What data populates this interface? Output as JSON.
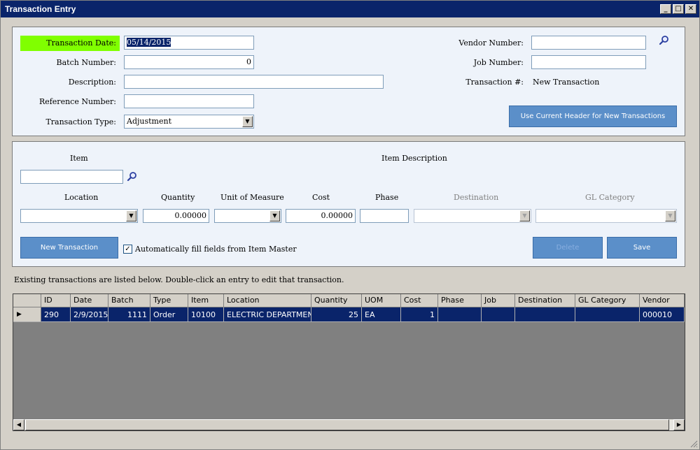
{
  "window": {
    "title": "Transaction Entry",
    "min_label": "_",
    "max_label": "□",
    "close_label": "✕"
  },
  "header": {
    "transaction_date_label": "Transaction Date:",
    "transaction_date_value": "05/14/2015",
    "batch_number_label": "Batch Number:",
    "batch_number_value": "0",
    "description_label": "Description:",
    "description_value": "",
    "reference_number_label": "Reference Number:",
    "reference_number_value": "",
    "transaction_type_label": "Transaction Type:",
    "transaction_type_value": "Adjustment",
    "vendor_number_label": "Vendor Number:",
    "vendor_number_value": "",
    "job_number_label": "Job Number:",
    "job_number_value": "",
    "transaction_no_label": "Transaction #:",
    "transaction_no_value": "New Transaction",
    "use_header_button": "Use Current Header for New Transactions",
    "accent_color": "#80ff00"
  },
  "detail": {
    "item_label": "Item",
    "item_value": "",
    "item_description_label": "Item Description",
    "location_label": "Location",
    "location_value": "",
    "quantity_label": "Quantity",
    "quantity_value": "0.00000",
    "uom_label": "Unit of Measure",
    "uom_value": "",
    "cost_label": "Cost",
    "cost_value": "0.00000",
    "phase_label": "Phase",
    "phase_value": "",
    "destination_label": "Destination",
    "destination_value": "",
    "gl_category_label": "GL Category",
    "gl_category_value": "",
    "new_transaction_button": "New Transaction",
    "autofill_label": "Automatically fill fields from Item Master",
    "autofill_checked": true,
    "delete_button": "Delete",
    "save_button": "Save"
  },
  "list": {
    "hint": "Existing transactions are listed below. Double-click an entry to edit that transaction.",
    "columns": [
      "ID",
      "Date",
      "Batch",
      "Type",
      "Item",
      "Location",
      "Quantity",
      "UOM",
      "Cost",
      "Phase",
      "Job",
      "Destination",
      "GL Category",
      "Vendor"
    ],
    "rows": [
      {
        "indicator": "▶",
        "cells": [
          "290",
          "2/9/2015",
          "1111",
          "Order",
          "10100",
          "ELECTRIC DEPARTMENT",
          "25",
          "EA",
          "1",
          "",
          "",
          "",
          "",
          "000010"
        ]
      }
    ],
    "scroll_left": "◀",
    "scroll_right": "▶"
  }
}
